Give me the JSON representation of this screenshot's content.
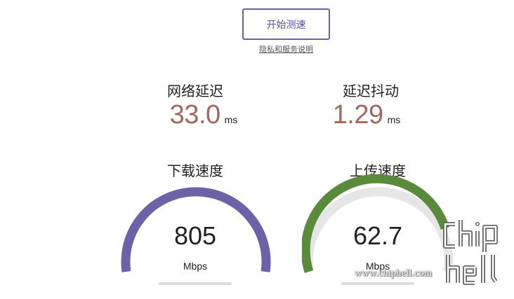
{
  "actions": {
    "start_label": "开始测速",
    "privacy_link": "隐私和服务说明"
  },
  "metrics": {
    "latency": {
      "label": "网络延迟",
      "value": "33.0",
      "unit": "ms"
    },
    "jitter": {
      "label": "延迟抖动",
      "value": "1.29",
      "unit": "ms"
    }
  },
  "gauges": {
    "download": {
      "title": "下载速度",
      "value": "805",
      "unit": "Mbps",
      "color": "#6b62a8"
    },
    "upload": {
      "title": "上传速度",
      "value": "62.7",
      "unit": "Mbps",
      "color": "#5a8a3c"
    }
  },
  "colors": {
    "accent": "#6b5fb0",
    "metric_value": "#a2675f",
    "gauge_track": "#e0e0e0"
  },
  "watermark": {
    "logo_text": "chip hell",
    "url": "www.chiphell.com"
  }
}
